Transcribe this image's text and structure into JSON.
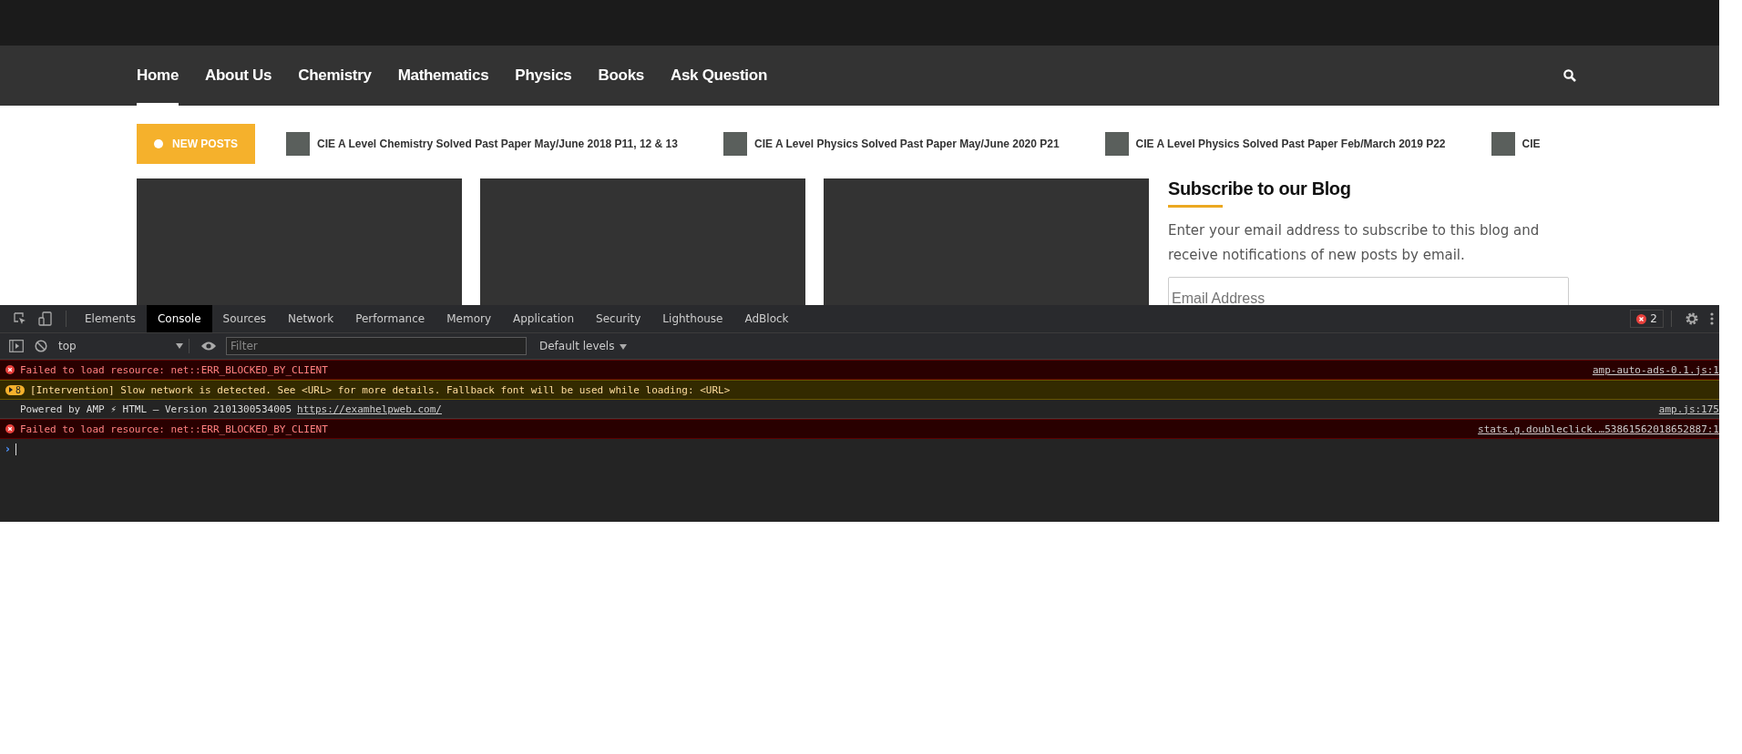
{
  "nav": {
    "items": [
      {
        "label": "Home",
        "selected": true
      },
      {
        "label": "About Us",
        "selected": false
      },
      {
        "label": "Chemistry",
        "selected": false
      },
      {
        "label": "Mathematics",
        "selected": false
      },
      {
        "label": "Physics",
        "selected": false
      },
      {
        "label": "Books",
        "selected": false
      },
      {
        "label": "Ask Question",
        "selected": false
      }
    ]
  },
  "ticker": {
    "badge": "NEW POSTS",
    "posts": [
      {
        "title": "CIE A Level Chemistry Solved Past Paper May/June 2018 P11, 12 & 13"
      },
      {
        "title": "CIE A Level Physics Solved Past Paper May/June 2020 P21"
      },
      {
        "title": "CIE A Level Physics Solved Past Paper Feb/March 2019 P22"
      },
      {
        "title": "CIE"
      }
    ]
  },
  "sidebar": {
    "title": "Subscribe to our Blog",
    "text": "Enter your email address to subscribe to this blog and receive notifications of new posts by email.",
    "email": {
      "placeholder": "Email Address"
    }
  },
  "devtools": {
    "tabs": [
      {
        "label": "Elements",
        "selected": false
      },
      {
        "label": "Console",
        "selected": true
      },
      {
        "label": "Sources",
        "selected": false
      },
      {
        "label": "Network",
        "selected": false
      },
      {
        "label": "Performance",
        "selected": false
      },
      {
        "label": "Memory",
        "selected": false
      },
      {
        "label": "Application",
        "selected": false
      },
      {
        "label": "Security",
        "selected": false
      },
      {
        "label": "Lighthouse",
        "selected": false
      },
      {
        "label": "AdBlock",
        "selected": false
      }
    ],
    "error_count": "2",
    "context": "top",
    "filter": {
      "placeholder": "Filter"
    },
    "levels": "Default levels",
    "messages": [
      {
        "kind": "error",
        "text": "Failed to load resource: net::ERR_BLOCKED_BY_CLIENT",
        "source": "amp-auto-ads-0.1.js:1"
      },
      {
        "kind": "warning",
        "count": "8",
        "text": "[Intervention] Slow network is detected. See <URL> for more details. Fallback font will be used while loading: <URL>"
      },
      {
        "kind": "info",
        "text": "Powered by AMP ⚡ HTML – Version 2101300534005",
        "link": "https://examhelpweb.com/",
        "source": "amp.js:175"
      },
      {
        "kind": "error",
        "text": "Failed to load resource: net::ERR_BLOCKED_BY_CLIENT",
        "source": "stats.g.doubleclick.…53861562018652887:1"
      }
    ],
    "prompt": "›"
  }
}
